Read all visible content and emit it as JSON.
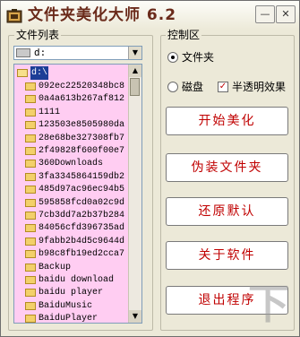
{
  "window": {
    "title": "文件夹美化大师 6.2",
    "minimize_glyph": "—",
    "close_glyph": "✕"
  },
  "file_panel": {
    "group_label": "文件列表",
    "drive_select": {
      "value": "d:",
      "arrow_glyph": "▼"
    },
    "tree": {
      "root": "d:\\",
      "items": [
        "092ec22520348bc8",
        "0a4a613b267af812",
        "1111",
        "123503e8505980da",
        "28e68be327308fb7",
        "2f49828f600f00e7",
        "360Downloads",
        "3fa3345864159db2",
        "485d97ac96ec94b5",
        "595858fcd0a02c9d",
        "7cb3dd7a2b37b284",
        "84056cfd396735ad",
        "9fabb2b4d5c9644d",
        "b98c8fb19ed2cca7",
        "Backup",
        "baidu download",
        "baidu player",
        "BaiduMusic",
        "BaiduPlayer"
      ],
      "scroll_up_glyph": "▲",
      "scroll_down_glyph": "▼"
    }
  },
  "control_panel": {
    "group_label": "控制区",
    "options": {
      "folder_label": "文件夹",
      "disk_label": "磁盘",
      "translucent_label": "半透明效果",
      "check_glyph": "✓"
    },
    "buttons": {
      "start": "开始美化",
      "disguise": "伪装文件夹",
      "restore": "还原默认",
      "about": "关于软件",
      "exit": "退出程序"
    }
  },
  "watermark": "下"
}
